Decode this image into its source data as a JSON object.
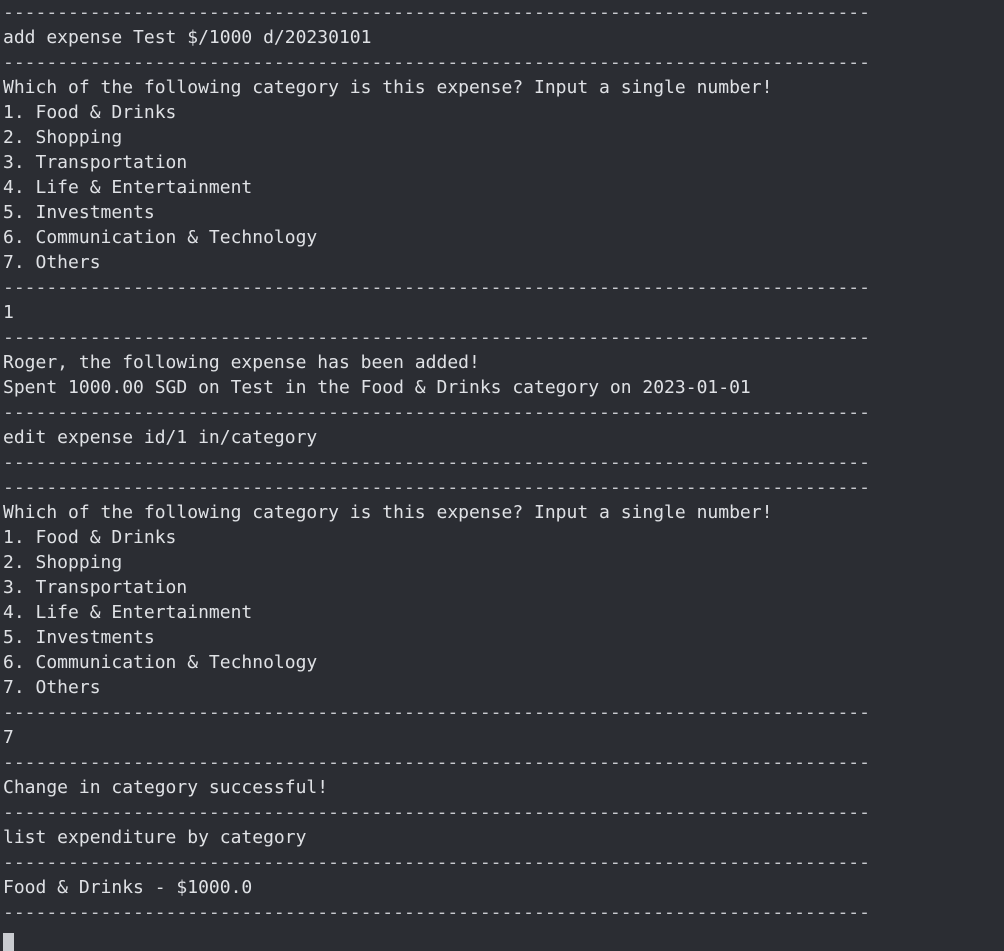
{
  "terminal": {
    "separator": "--------------------------------------------------------------------------------",
    "lines": [
      {
        "type": "sep"
      },
      {
        "type": "text",
        "text": "add expense Test $/1000 d/20230101",
        "name": "user-command"
      },
      {
        "type": "sep"
      },
      {
        "type": "text",
        "text": "Which of the following category is this expense? Input a single number!",
        "name": "prompt-line"
      },
      {
        "type": "text",
        "text": "1. Food & Drinks",
        "name": "category-option"
      },
      {
        "type": "text",
        "text": "2. Shopping",
        "name": "category-option"
      },
      {
        "type": "text",
        "text": "3. Transportation",
        "name": "category-option"
      },
      {
        "type": "text",
        "text": "4. Life & Entertainment",
        "name": "category-option"
      },
      {
        "type": "text",
        "text": "5. Investments",
        "name": "category-option"
      },
      {
        "type": "text",
        "text": "6. Communication & Technology",
        "name": "category-option"
      },
      {
        "type": "text",
        "text": "7. Others",
        "name": "category-option"
      },
      {
        "type": "sep"
      },
      {
        "type": "text",
        "text": "1",
        "name": "user-input"
      },
      {
        "type": "sep"
      },
      {
        "type": "text",
        "text": "Roger, the following expense has been added!",
        "name": "output-line"
      },
      {
        "type": "text",
        "text": "Spent 1000.00 SGD on Test in the Food & Drinks category on 2023-01-01",
        "name": "output-line"
      },
      {
        "type": "sep"
      },
      {
        "type": "text",
        "text": "edit expense id/1 in/category",
        "name": "user-command"
      },
      {
        "type": "sep"
      },
      {
        "type": "sep"
      },
      {
        "type": "text",
        "text": "Which of the following category is this expense? Input a single number!",
        "name": "prompt-line"
      },
      {
        "type": "text",
        "text": "1. Food & Drinks",
        "name": "category-option"
      },
      {
        "type": "text",
        "text": "2. Shopping",
        "name": "category-option"
      },
      {
        "type": "text",
        "text": "3. Transportation",
        "name": "category-option"
      },
      {
        "type": "text",
        "text": "4. Life & Entertainment",
        "name": "category-option"
      },
      {
        "type": "text",
        "text": "5. Investments",
        "name": "category-option"
      },
      {
        "type": "text",
        "text": "6. Communication & Technology",
        "name": "category-option"
      },
      {
        "type": "text",
        "text": "7. Others",
        "name": "category-option"
      },
      {
        "type": "sep"
      },
      {
        "type": "text",
        "text": "7",
        "name": "user-input"
      },
      {
        "type": "sep"
      },
      {
        "type": "text",
        "text": "Change in category successful!",
        "name": "output-line"
      },
      {
        "type": "sep"
      },
      {
        "type": "text",
        "text": "list expenditure by category",
        "name": "user-command"
      },
      {
        "type": "sep"
      },
      {
        "type": "text",
        "text": "Food & Drinks - $1000.0",
        "name": "output-line"
      },
      {
        "type": "sep"
      }
    ]
  }
}
